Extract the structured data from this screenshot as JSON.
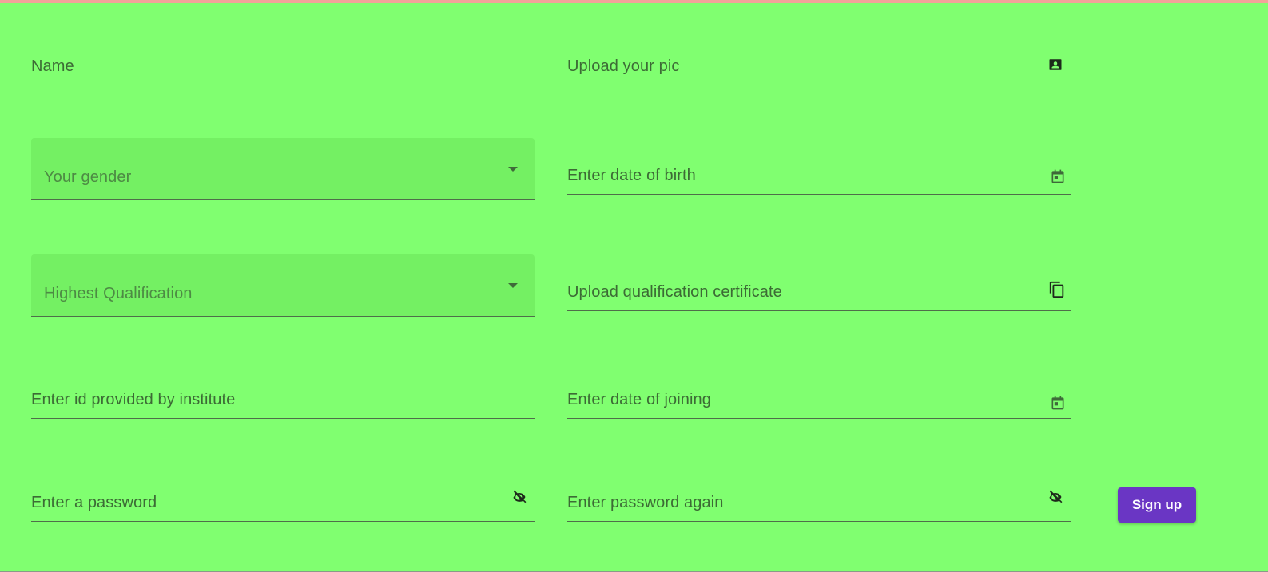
{
  "form": {
    "name_label": "Name",
    "photo_label": "Upload your pic",
    "gender_label": "Your gender",
    "dob_label": "Enter date of birth",
    "qualification_label": "Highest Qualification",
    "certificate_label": "Upload qualification certificate",
    "institute_id_label": "Enter id provided by institute",
    "doj_label": "Enter date of joining",
    "password_label": "Enter a password",
    "password_again_label": "Enter password again",
    "signup_label": "Sign up"
  },
  "icons": {
    "photo": "contact-card-icon",
    "dob": "calendar-icon",
    "certificate": "copy-icon",
    "doj": "calendar-icon",
    "password": "visibility-off-icon",
    "password_again": "visibility-off-icon",
    "dropdown": "dropdown-arrow-icon"
  },
  "colors": {
    "background": "#80ff70",
    "primary_button": "#6a36c4",
    "top_accent": "#f3a39a"
  }
}
